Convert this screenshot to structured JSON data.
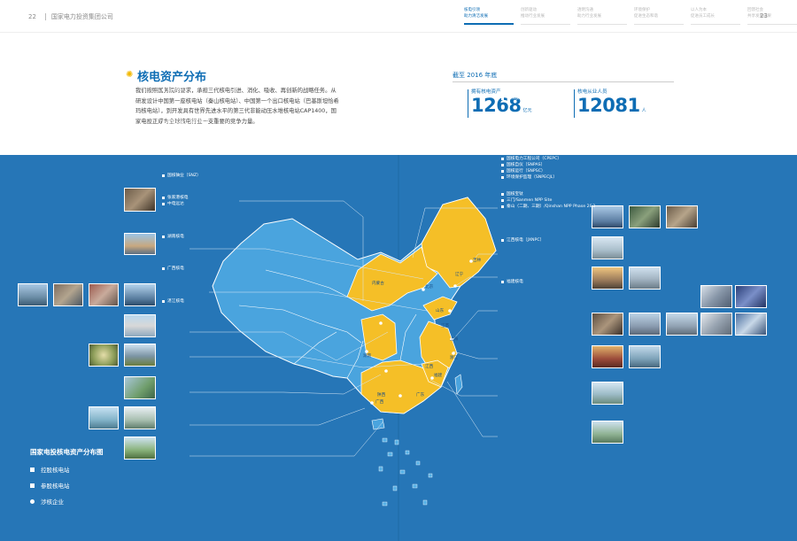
{
  "header": {
    "left_page": "22",
    "company": "国家电力投资集团公司",
    "right_page": "23",
    "tabs": [
      {
        "line1": "核电引领",
        "line2": "助力清洁发展",
        "active": true
      },
      {
        "line1": "创新驱动",
        "line2": "推动行业发展",
        "active": false
      },
      {
        "line1": "透明沟通",
        "line2": "助力行业发展",
        "active": false
      },
      {
        "line1": "环境保护",
        "line2": "促进生态和谐",
        "active": false
      },
      {
        "line1": "以人为本",
        "line2": "促进员工成长",
        "active": false
      },
      {
        "line1": "回馈社会",
        "line2": "共享发展成果",
        "active": false
      }
    ]
  },
  "section": {
    "icon": "atom-icon",
    "title": "核电资产分布",
    "body": "我们按照国务院的要求，承担三代核电引进、消化、吸收、再创新的战略任务。从研发设计中国第一座核电站（秦山核电站）、中国第一个出口核电站（巴基斯坦恰希玛核电站），到开发具有世界先进水平的第三代非能动压水堆核电站CAP1400，国家电投正成为全球核电行业一支重要的竞争力量。"
  },
  "stats": {
    "as_of": "截至 2016 年底",
    "items": [
      {
        "label": "拥有核电资产",
        "value": "1268",
        "unit": "亿元"
      },
      {
        "label": "核电从业人员",
        "value": "12081",
        "unit": "人"
      }
    ]
  },
  "map": {
    "left_labels": [
      {
        "lines": [
          "中钢和合核燃料元件股份公司（参股）"
        ]
      },
      {
        "lines": [
          "辽宁核电",
          "红沿河核电"
        ]
      },
      {
        "lines": [
          "山东核电（SDNPC）",
          "国核设备（SNPEMC）",
          "国核示范（SNPDP）",
          "山东院（SDEPCI）",
          "石岛湾/Shidao Bay NPP Unit1&2",
          "海阳/Haiyang NPP Site"
        ]
      },
      {
        "lines": [
          "国核铀业（SNZ）"
        ]
      },
      {
        "lines": [
          "张家港核电",
          "中电远达"
        ]
      },
      {
        "lines": [
          "湖南核电"
        ]
      },
      {
        "lines": [
          "广西核电"
        ]
      },
      {
        "lines": [
          "湛江核电"
        ]
      }
    ],
    "right_labels": [
      {
        "lines": [
          "国家核电技术公司（SNPTC）",
          "国核电力院（SNPDRI）",
          "国家电投中央研究院（SPIRI）",
          "国核爱克（JV）"
        ]
      },
      {
        "lines": [
          "吉林核电"
        ]
      },
      {
        "lines": [
          "国核锆铪理化公司（SNWZH）",
          "荣成/Sanwan NPP Unit & 2"
        ]
      },
      {
        "lines": [
          "上海院工院（SNERDI）",
          "上海成套院（SPERI）",
          "国核工程（SNPEC）",
          "国核电力工程公司（CPEPC）",
          "国核自仪（SNPAS）",
          "国核运行（SNPSC）",
          "环境保护监理（SNPECJL）"
        ]
      },
      {
        "lines": [
          "国核宝钛",
          "三门/Sanmen NPP Site",
          "秦山（二期、三期）/Qinshan NPP Phase 2&3"
        ]
      },
      {
        "lines": [
          "江西核电（JXNPC）"
        ]
      },
      {
        "lines": [
          "福建核电"
        ]
      }
    ],
    "provinces": [
      "吉林",
      "辽宁",
      "内蒙古",
      "北京",
      "山东",
      "江苏",
      "上海",
      "浙江",
      "江西",
      "湖南",
      "陕西",
      "福建",
      "广东",
      "广西"
    ],
    "colors": {
      "panel": "#2676b7",
      "land": "#4aa4de",
      "nuclear": "#f5bf27",
      "border": "#ffffff"
    }
  },
  "legend": {
    "title": "国家电投核电资产分布图",
    "items": [
      {
        "label": "控股核电站",
        "shape": "square"
      },
      {
        "label": "参股核电站",
        "shape": "square"
      },
      {
        "label": "涉核企业",
        "shape": "dot"
      }
    ]
  }
}
